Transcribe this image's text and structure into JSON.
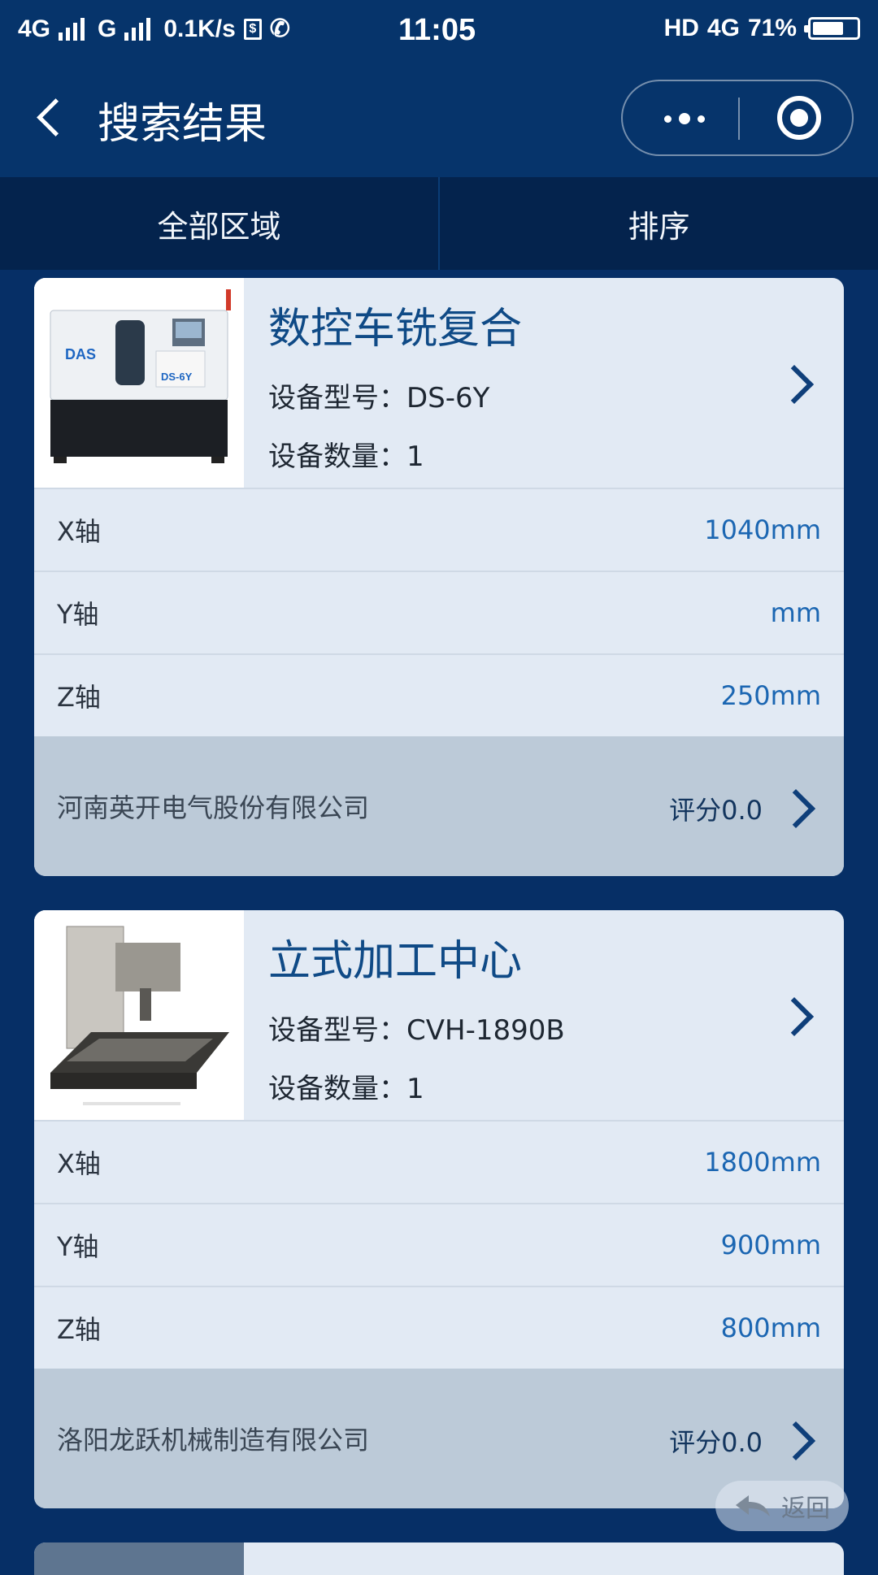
{
  "status_bar": {
    "network_left": "4G",
    "network_second": "G",
    "speed": "0.1K/s",
    "time": "11:05",
    "hd": "HD",
    "network_right": "4G",
    "battery_percent": "71%",
    "battery_level": 0.71
  },
  "nav": {
    "title": "搜索结果"
  },
  "filters": [
    {
      "label": "全部区域"
    },
    {
      "label": "排序"
    }
  ],
  "items": [
    {
      "title": "数控车铣复合",
      "model": "设备型号：DS-6Y",
      "count": "设备数量：1",
      "image_brand": "DAS",
      "image_model": "DS-6Y",
      "specs": [
        {
          "axis": "X轴",
          "value": "1040mm"
        },
        {
          "axis": "Y轴",
          "value": "mm"
        },
        {
          "axis": "Z轴",
          "value": "250mm"
        }
      ],
      "company": "河南英开电气股份有限公司",
      "rating": "评分0.0"
    },
    {
      "title": "立式加工中心",
      "model": "设备型号：CVH-1890B",
      "count": "设备数量：1",
      "specs": [
        {
          "axis": "X轴",
          "value": "1800mm"
        },
        {
          "axis": "Y轴",
          "value": "900mm"
        },
        {
          "axis": "Z轴",
          "value": "800mm"
        }
      ],
      "company": "洛阳龙跃机械制造有限公司",
      "rating": "评分0.0"
    }
  ],
  "return_button": {
    "label": "返回"
  },
  "colors": {
    "primary_bg": "#062f66",
    "header_bg": "#06346b",
    "filter_bg": "#04234d",
    "card_bg": "#e2eaf4",
    "footer_bg": "#bccad8",
    "title_blue": "#0f4a86",
    "value_blue": "#1b66b2"
  }
}
